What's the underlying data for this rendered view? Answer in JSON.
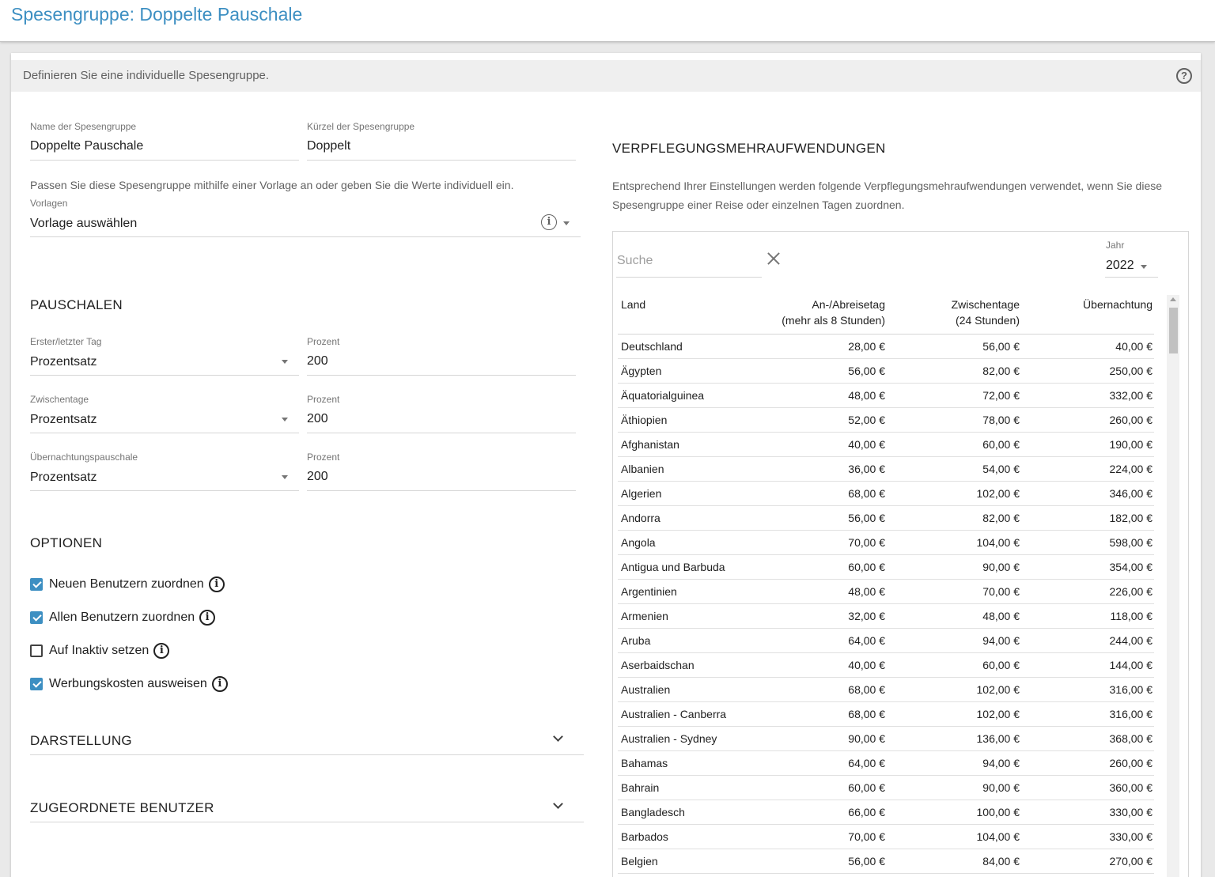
{
  "page": {
    "title": "Spesengruppe: Doppelte Pauschale"
  },
  "card": {
    "hint": "Definieren Sie eine individuelle Spesengruppe."
  },
  "form": {
    "name_label": "Name der Spesengruppe",
    "name_value": "Doppelte Pauschale",
    "short_label": "Kürzel der Spesengruppe",
    "short_value": "Doppelt",
    "template_note": "Passen Sie diese Spesengruppe mithilfe einer Vorlage an oder geben Sie die Werte individuell ein.",
    "template_label": "Vorlagen",
    "template_value": "Vorlage auswählen"
  },
  "pauschalen": {
    "heading": "PAUSCHALEN",
    "rows": [
      {
        "label": "Erster/letzter Tag",
        "value": "Prozentsatz",
        "percent_label": "Prozent",
        "percent_value": "200"
      },
      {
        "label": "Zwischentage",
        "value": "Prozentsatz",
        "percent_label": "Prozent",
        "percent_value": "200"
      },
      {
        "label": "Übernachtungspauschale",
        "value": "Prozentsatz",
        "percent_label": "Prozent",
        "percent_value": "200"
      }
    ]
  },
  "optionen": {
    "heading": "OPTIONEN",
    "items": [
      {
        "label": "Neuen Benutzern zuordnen",
        "checked": true
      },
      {
        "label": "Allen Benutzern zuordnen",
        "checked": true
      },
      {
        "label": "Auf Inaktiv setzen",
        "checked": false
      },
      {
        "label": "Werbungskosten ausweisen",
        "checked": true
      }
    ]
  },
  "darstellung": {
    "heading": "DARSTELLUNG"
  },
  "zugeordnete": {
    "heading": "ZUGEORDNETE BENUTZER"
  },
  "verpflegung": {
    "heading": "VERPFLEGUNGSMEHRAUFWENDUNGEN",
    "note": "Entsprechend Ihrer Einstellungen werden folgende Verpflegungsmehraufwendungen verwendet, wenn Sie diese Spesengruppe einer Reise oder einzelnen Tagen zuordnen.",
    "search_placeholder": "Suche",
    "year_label": "Jahr",
    "year_value": "2022",
    "columns": {
      "land": "Land",
      "arrival_line1": "An-/Abreisetag",
      "arrival_line2": "(mehr als 8 Stunden)",
      "middle_line1": "Zwischentage",
      "middle_line2": "(24 Stunden)",
      "night": "Übernachtung"
    },
    "rows": [
      [
        "Deutschland",
        "28,00 €",
        "56,00 €",
        "40,00 €"
      ],
      [
        "Ägypten",
        "56,00 €",
        "82,00 €",
        "250,00 €"
      ],
      [
        "Äquatorialguinea",
        "48,00 €",
        "72,00 €",
        "332,00 €"
      ],
      [
        "Äthiopien",
        "52,00 €",
        "78,00 €",
        "260,00 €"
      ],
      [
        "Afghanistan",
        "40,00 €",
        "60,00 €",
        "190,00 €"
      ],
      [
        "Albanien",
        "36,00 €",
        "54,00 €",
        "224,00 €"
      ],
      [
        "Algerien",
        "68,00 €",
        "102,00 €",
        "346,00 €"
      ],
      [
        "Andorra",
        "56,00 €",
        "82,00 €",
        "182,00 €"
      ],
      [
        "Angola",
        "70,00 €",
        "104,00 €",
        "598,00 €"
      ],
      [
        "Antigua und Barbuda",
        "60,00 €",
        "90,00 €",
        "354,00 €"
      ],
      [
        "Argentinien",
        "48,00 €",
        "70,00 €",
        "226,00 €"
      ],
      [
        "Armenien",
        "32,00 €",
        "48,00 €",
        "118,00 €"
      ],
      [
        "Aruba",
        "64,00 €",
        "94,00 €",
        "244,00 €"
      ],
      [
        "Aserbaidschan",
        "40,00 €",
        "60,00 €",
        "144,00 €"
      ],
      [
        "Australien",
        "68,00 €",
        "102,00 €",
        "316,00 €"
      ],
      [
        "Australien - Canberra",
        "68,00 €",
        "102,00 €",
        "316,00 €"
      ],
      [
        "Australien - Sydney",
        "90,00 €",
        "136,00 €",
        "368,00 €"
      ],
      [
        "Bahamas",
        "64,00 €",
        "94,00 €",
        "260,00 €"
      ],
      [
        "Bahrain",
        "60,00 €",
        "90,00 €",
        "360,00 €"
      ],
      [
        "Bangladesch",
        "66,00 €",
        "100,00 €",
        "330,00 €"
      ],
      [
        "Barbados",
        "70,00 €",
        "104,00 €",
        "330,00 €"
      ],
      [
        "Belgien",
        "56,00 €",
        "84,00 €",
        "270,00 €"
      ]
    ]
  }
}
